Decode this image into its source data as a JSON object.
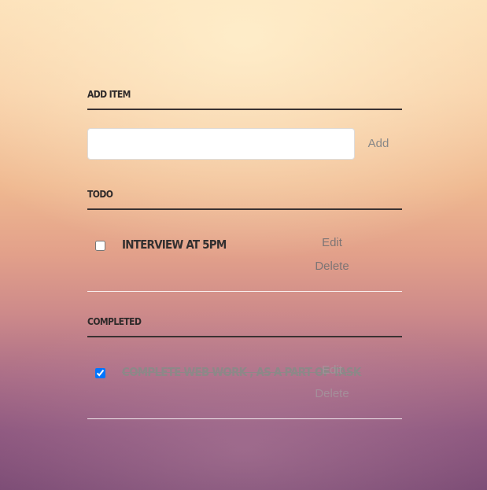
{
  "add_item": {
    "heading": "Add item",
    "input_value": "",
    "button_label": "Add"
  },
  "todo": {
    "heading": "Todo",
    "tasks": [
      {
        "label": "Interview at 5pm",
        "checked": false,
        "edit_label": "Edit",
        "delete_label": "Delete"
      }
    ]
  },
  "completed": {
    "heading": "Completed",
    "tasks": [
      {
        "label": "Complete web work , as a part of task",
        "checked": true,
        "edit_label": "Edit",
        "delete_label": "Delete"
      }
    ]
  }
}
